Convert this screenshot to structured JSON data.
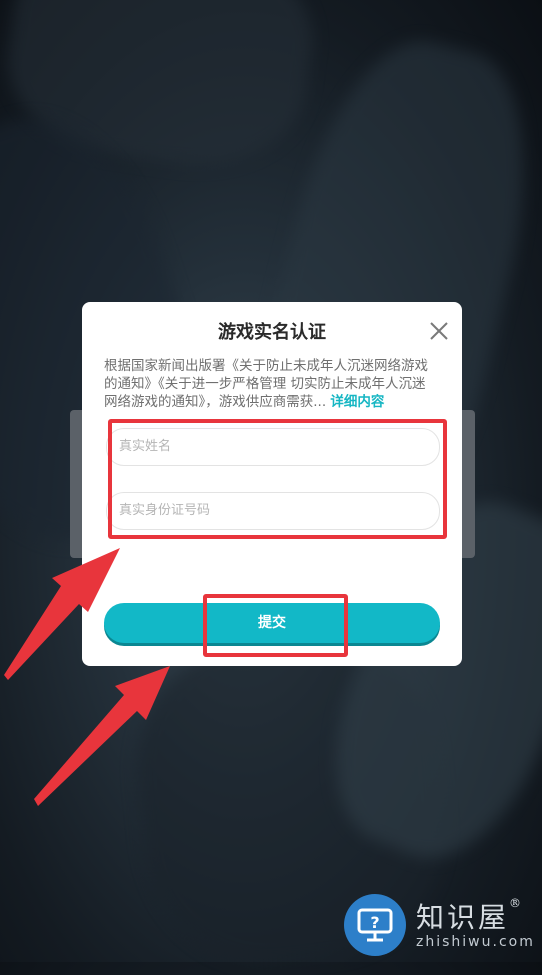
{
  "dialog": {
    "title": "游戏实名认证",
    "notice_line1": "根据国家新闻出版署《关于防止未成年人沉迷网络游戏",
    "notice_line2": "的通知》《关于进一步严格管理 切实防止未成年人沉迷",
    "notice_line3": "网络游戏的通知》，游戏供应商需获...",
    "more_link": "详细内容",
    "name_placeholder": "真实姓名",
    "id_placeholder": "真实身份证号码",
    "submit_label": "提交"
  },
  "watermark": {
    "brand": "知识屋",
    "registered": "®",
    "domain": "zhishiwu.com"
  },
  "colors": {
    "accent": "#12b8c7",
    "highlight": "#e8353c",
    "link": "#16b6c3"
  },
  "icons": [
    "close-icon",
    "arrow-icon",
    "help-monitor-icon"
  ]
}
